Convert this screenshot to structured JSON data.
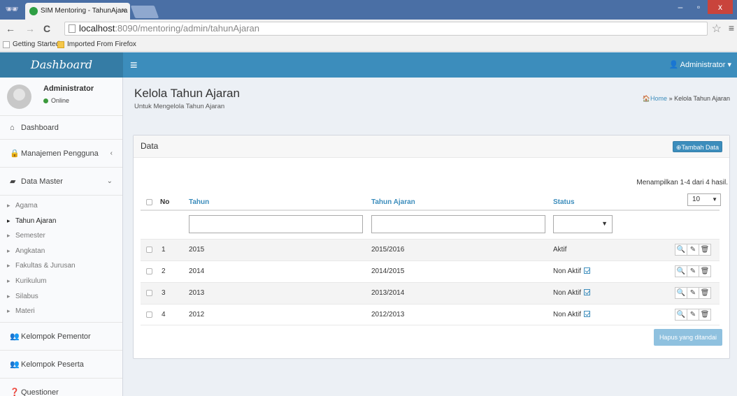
{
  "browser": {
    "tab_title": "SIM Mentoring - TahunAjara",
    "tab_close": "×",
    "url_host": "localhost",
    "url_rest": ":8090/mentoring/admin/tahunAjaran",
    "back": "←",
    "forward": "→",
    "reload": "C",
    "bookmarks": [
      "Getting Started",
      "Imported From Firefox"
    ],
    "window_controls": [
      "–",
      "▫",
      "x"
    ]
  },
  "app": {
    "logo": "Dashboard",
    "user_menu": "Administrator ▾"
  },
  "sidebar": {
    "user_name": "Administrator",
    "user_status": "Online",
    "items": {
      "dashboard": "Dashboard",
      "manajemen": "Manajemen Pengguna",
      "data_master": "Data Master",
      "kelompok_pementor": "Kelompok Pementor",
      "kelompok_peserta": "Kelompok Peserta",
      "questioner": "Questioner"
    },
    "submenu": [
      "Agama",
      "Tahun Ajaran",
      "Semester",
      "Angkatan",
      "Fakultas & Jurusan",
      "Kurikulum",
      "Silabus",
      "Materi"
    ],
    "active_submenu": "Tahun Ajaran"
  },
  "page": {
    "title": "Kelola Tahun Ajaran",
    "subtitle": "Untuk Mengelola Tahun Ajaran",
    "breadcrumb_home": "Home",
    "breadcrumb_sep": "»",
    "breadcrumb_current": "Kelola Tahun Ajaran"
  },
  "box": {
    "title": "Data",
    "add_button": "Tambah Data",
    "summary": "Menampilkan 1-4 dari 4 hasil.",
    "per_page": "10",
    "delete_button": "Hapus yang ditandai"
  },
  "table": {
    "headers": {
      "no": "No",
      "tahun": "Tahun",
      "tahun_ajaran": "Tahun Ajaran",
      "status": "Status"
    },
    "rows": [
      {
        "no": "1",
        "tahun": "2015",
        "tahun_ajaran": "2015/2016",
        "status": "Aktif",
        "toggle": false
      },
      {
        "no": "2",
        "tahun": "2014",
        "tahun_ajaran": "2014/2015",
        "status": "Non Aktif",
        "toggle": true
      },
      {
        "no": "3",
        "tahun": "2013",
        "tahun_ajaran": "2013/2014",
        "status": "Non Aktif",
        "toggle": true
      },
      {
        "no": "4",
        "tahun": "2012",
        "tahun_ajaran": "2012/2013",
        "status": "Non Aktif",
        "toggle": true
      }
    ]
  },
  "colors": {
    "primary": "#3c8dbc",
    "logo_bg": "#357ca5"
  }
}
